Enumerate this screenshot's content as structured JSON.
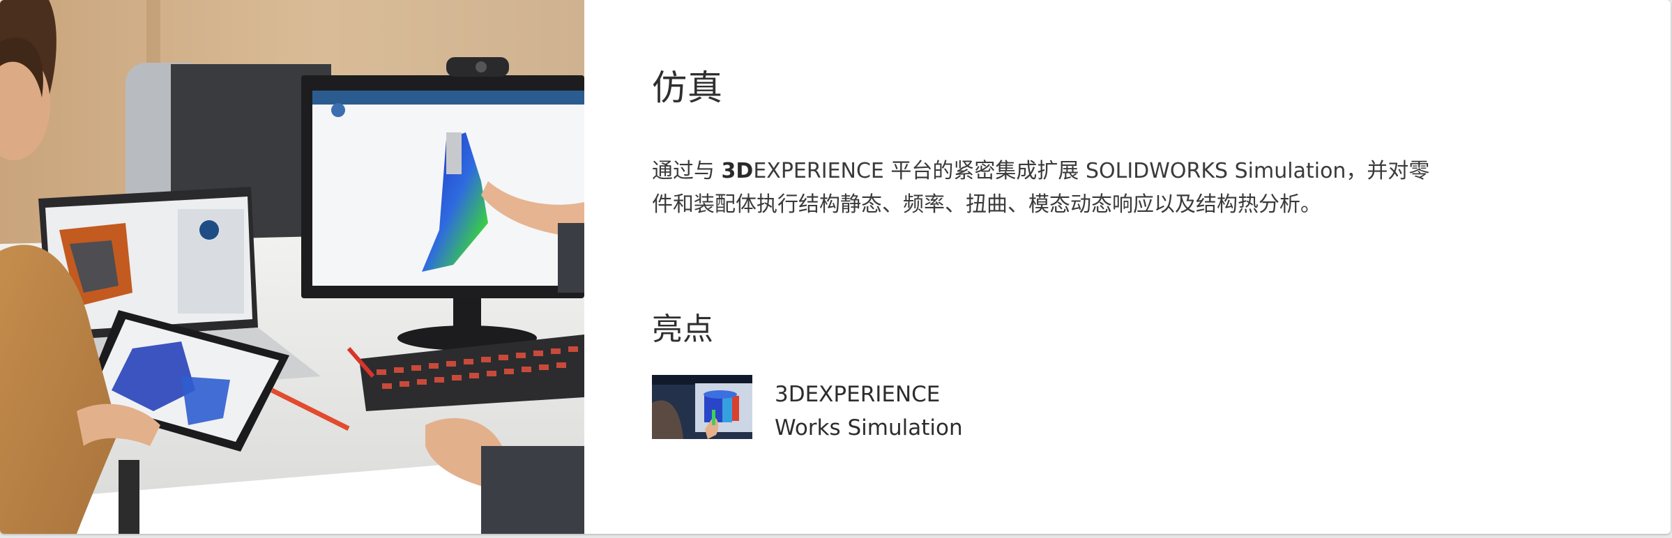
{
  "section": {
    "title": "仿真",
    "description_bold": "3D",
    "description_rest": "EXPERIENCE 平台的紧密集成扩展 SOLIDWORKS Simulation，并对零件和装配体执行结构静态、频率、扭曲、模态动态响应以及结构热分析。",
    "description_prefix": "通过与 "
  },
  "highlights": {
    "title": "亮点",
    "items": [
      {
        "line1": "3DEXPERIENCE",
        "line2": "Works Simulation"
      }
    ]
  },
  "colors": {
    "text": "#2f2f2f",
    "background": "#ffffff",
    "fea_blue": "#1f3fc8",
    "fea_green": "#2fd04a",
    "keyboard_red": "#d8352a"
  }
}
